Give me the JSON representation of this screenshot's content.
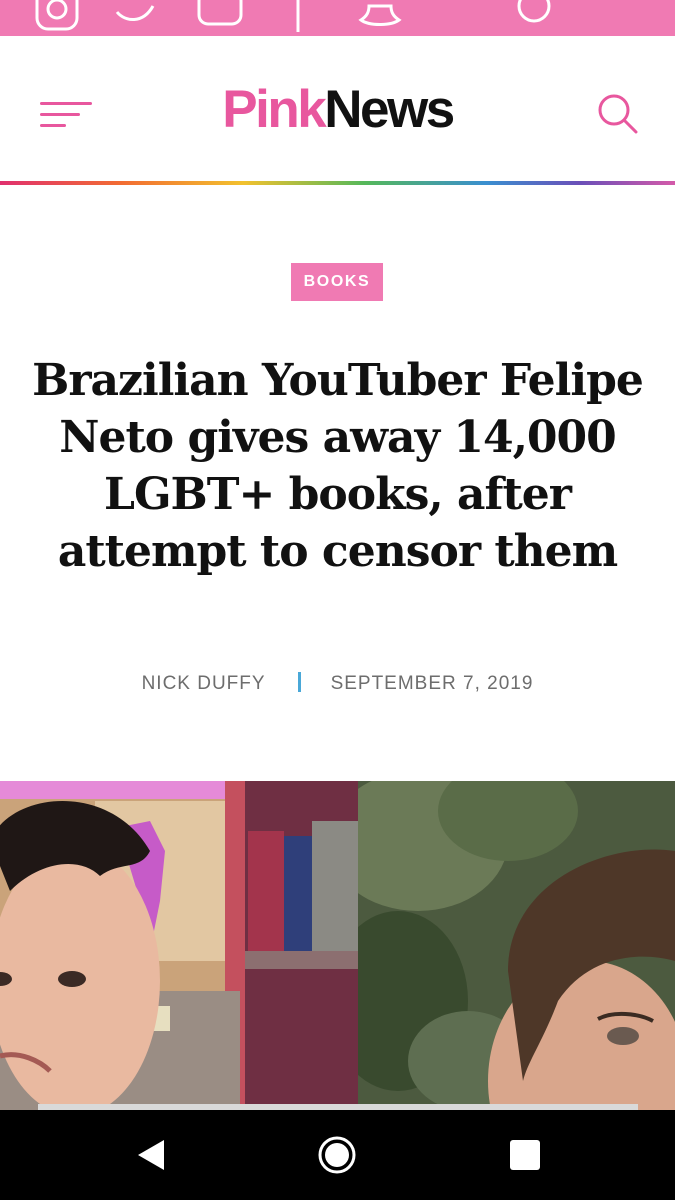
{
  "colors": {
    "brand_pink": "#e8579e",
    "strip_pink": "#f07ab3",
    "byline_separator": "#4aa8d8"
  },
  "social_icons": [
    "instagram-icon",
    "twitter-icon",
    "youtube-icon",
    "facebook-icon",
    "snapchat-icon",
    "other-social-icon"
  ],
  "header": {
    "logo_pink": "Pink",
    "logo_dark": "News",
    "menu_icon": "hamburger-menu-icon",
    "search_icon": "search-icon"
  },
  "article": {
    "category": "BOOKS",
    "headline": "Brazilian YouTuber Felipe Neto gives away 14,000 LGBT+ books, after attempt to censor them",
    "author": "NICK DUFFY",
    "date": "SEPTEMBER 7, 2019"
  },
  "system_nav": {
    "back_icon": "back-triangle-icon",
    "home_icon": "home-circle-icon",
    "recents_icon": "recents-square-icon"
  }
}
